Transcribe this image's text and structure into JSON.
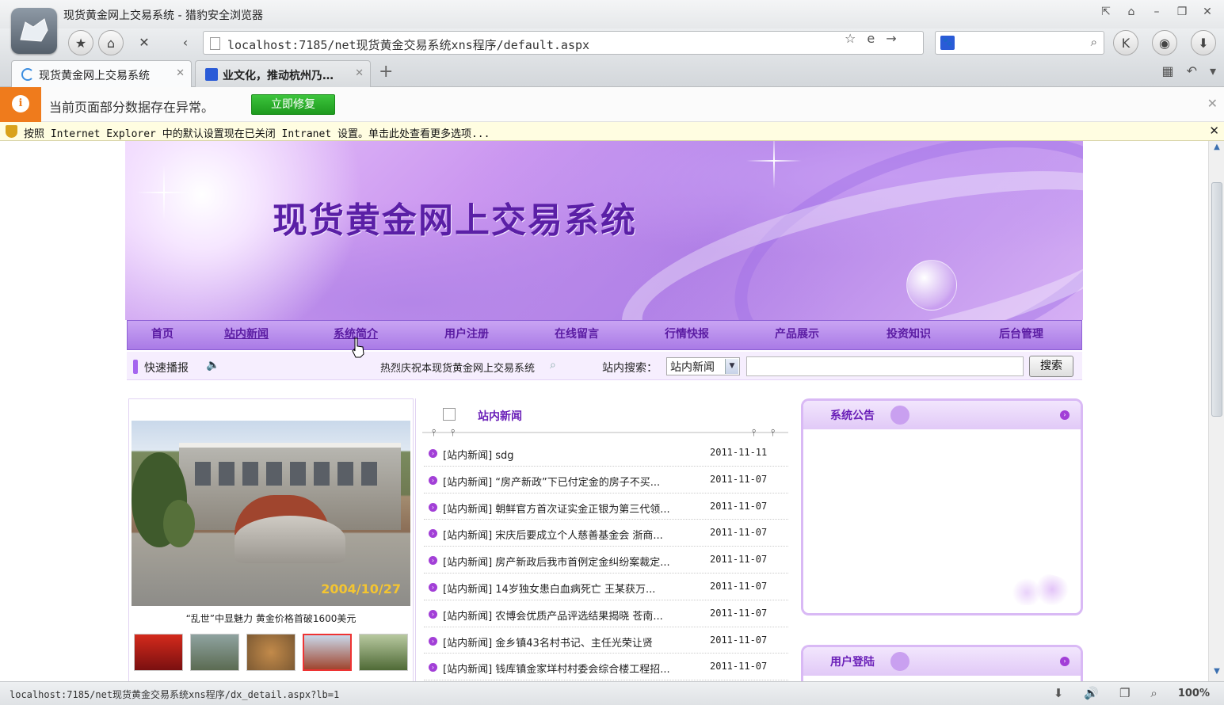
{
  "browser": {
    "window_title": "现货黄金网上交易系统 - 猎豹安全浏览器",
    "url": "localhost:7185/net现货黄金交易系统xns程序/default.aspx",
    "tabs": [
      {
        "label": "现货黄金网上交易系统",
        "active": true
      },
      {
        "label": "业文化，推动杭州乃…",
        "active": false
      }
    ],
    "warning_text": "当前页面部分数据存在异常。",
    "fix_button": "立即修复",
    "ie_notice": "按照 Internet Explorer 中的默认设置现在已关闭 Intranet 设置。单击此处查看更多选项...",
    "status_url": "localhost:7185/net现货黄金交易系统xns程序/dx_detail.aspx?lb=1",
    "zoom": "100%"
  },
  "site": {
    "banner_title": "现货黄金网上交易系统",
    "menu": [
      "首页",
      "站内新闻",
      "系统简介",
      "用户注册",
      "在线留言",
      "行情快报",
      "产品展示",
      "投资知识",
      "后台管理"
    ],
    "ticker": {
      "label": "快速播报",
      "text": "热烈庆祝本现货黄金网上交易系统",
      "search_label": "站内搜索：",
      "search_scope": "站内新闻",
      "search_button": "搜索"
    },
    "photo": {
      "date": "2004/10/27",
      "caption": "“乱世”中显魅力 黄金价格首破1600美元"
    },
    "news": {
      "title": "站内新闻",
      "items": [
        {
          "text": "[站内新闻] sdg",
          "date": "2011-11-11"
        },
        {
          "text": "[站内新闻] “房产新政”下已付定金的房子不买...",
          "date": "2011-11-07"
        },
        {
          "text": "[站内新闻] 朝鲜官方首次证实金正银为第三代领...",
          "date": "2011-11-07"
        },
        {
          "text": "[站内新闻] 宋庆后要成立个人慈善基金会 浙商...",
          "date": "2011-11-07"
        },
        {
          "text": "[站内新闻] 房产新政后我市首例定金纠纷案裁定...",
          "date": "2011-11-07"
        },
        {
          "text": "[站内新闻] 14岁独女患白血病死亡 王某获万...",
          "date": "2011-11-07"
        },
        {
          "text": "[站内新闻] 农博会优质产品评选结果揭晓 苍南...",
          "date": "2011-11-07"
        },
        {
          "text": "[站内新闻] 金乡镇43名村书记、主任光荣让贤",
          "date": "2011-11-07"
        },
        {
          "text": "[站内新闻] 钱库镇金家垟村村委会综合楼工程招...",
          "date": "2011-11-07"
        }
      ]
    },
    "notice_title": "系统公告",
    "login_title": "用户登陆"
  },
  "colors": {
    "accent": "#6a1fb8",
    "menu_bg": "#b589ea",
    "warning": "#ef7b1c",
    "fix_button": "#2aaa2a"
  }
}
